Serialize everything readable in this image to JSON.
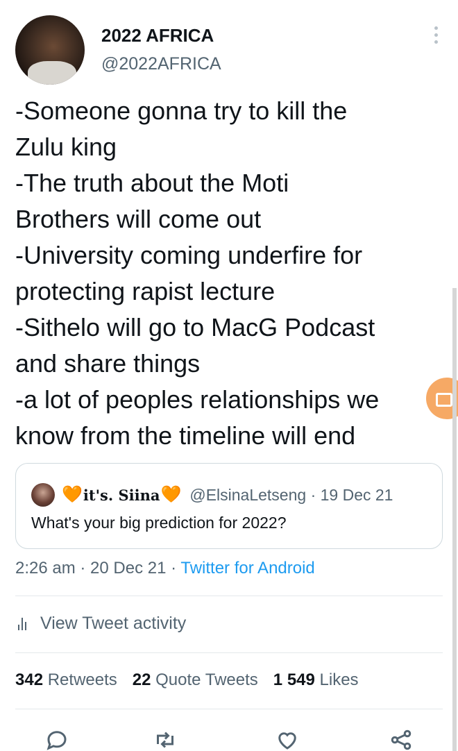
{
  "author": {
    "name": "2022 AFRICA",
    "handle": "@2022AFRICA"
  },
  "tweet": {
    "lines": [
      "-Someone gonna try to kill the",
      "Zulu king",
      "-The truth about the Moti",
      "Brothers will come out",
      "-University coming underfire for",
      "protecting rapist lecture",
      "-Sithelo will go to MacG Podcast",
      "and share things",
      "-a lot of peoples relationships we",
      "know from the timeline will end"
    ]
  },
  "quote": {
    "heart_left": "🧡",
    "name": "it's. Siina",
    "heart_right": "🧡",
    "handle_date": "@ElsinaLetseng · 19 Dec 21",
    "text": "What's your big prediction for 2022?"
  },
  "meta": {
    "time_date": "2:26 am · 20 Dec 21 · ",
    "source": "Twitter for Android"
  },
  "activity": {
    "label": "View Tweet activity"
  },
  "stats": {
    "retweets_count": "342",
    "retweets_label": "Retweets",
    "quotes_count": "22",
    "quotes_label": "Quote Tweets",
    "likes_count": "1 549",
    "likes_label": "Likes"
  },
  "icons": {
    "more": "more-vertical-icon",
    "activity": "bar-chart-icon",
    "reply": "reply-icon",
    "retweet": "retweet-icon",
    "like": "heart-icon",
    "share": "share-icon"
  },
  "colors": {
    "link": "#1d9bf0",
    "secondary_text": "#536471",
    "floating_button": "#f6a965"
  }
}
